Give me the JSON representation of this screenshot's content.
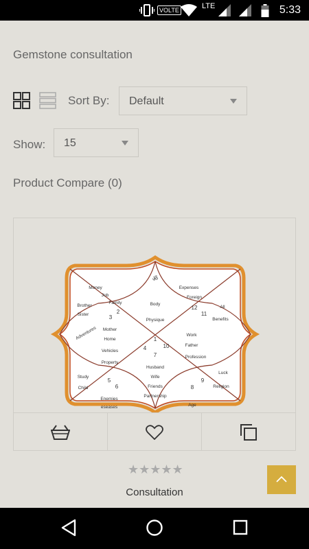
{
  "status_bar": {
    "time": "5:33",
    "network": "LTE",
    "volte": "VOLTE",
    "icons": [
      "vibrate-icon",
      "wifi-icon",
      "signal-icon",
      "signal-icon",
      "battery-icon"
    ]
  },
  "page": {
    "title": "Gemstone consultation",
    "sort": {
      "label": "Sort By:",
      "value": "Default"
    },
    "show": {
      "label": "Show:",
      "value": "15"
    },
    "compare": "Product Compare (0)",
    "view_modes": [
      "grid-view-icon",
      "list-view-icon"
    ]
  },
  "product": {
    "name": "Consultation",
    "rating": 0,
    "rating_max": 5,
    "stars": "★★★★★",
    "actions": [
      "add-to-cart-icon",
      "wishlist-icon",
      "compare-icon"
    ],
    "chart": {
      "colors": {
        "outer": "#d87a2a",
        "inner": "#c24a1f",
        "lines": "#8a3a2a",
        "text": "#333"
      },
      "houses": [
        {
          "num": "1",
          "lines": [
            "Body",
            "Physique"
          ]
        },
        {
          "num": "2",
          "lines": [
            "Money",
            "Job",
            "Family"
          ]
        },
        {
          "num": "3",
          "lines": [
            "Brother",
            "Sister"
          ]
        },
        {
          "num": "4",
          "lines": [
            "Mother",
            "Home",
            "Vehicles",
            "Property"
          ]
        },
        {
          "num": "5",
          "lines": [
            "Study",
            "Child"
          ]
        },
        {
          "num": "6",
          "lines": [
            "Enemies",
            "eseases"
          ]
        },
        {
          "num": "7",
          "lines": [
            "Husband",
            "Wife",
            "Friends",
            "Partnership"
          ]
        },
        {
          "num": "8",
          "lines": [
            "Age"
          ]
        },
        {
          "num": "9",
          "lines": [
            "Luck",
            "Religion"
          ]
        },
        {
          "num": "10",
          "lines": [
            "Work",
            "Father",
            "Profession"
          ]
        },
        {
          "num": "11",
          "lines": [
            "All",
            "Benefits"
          ]
        },
        {
          "num": "12",
          "lines": [
            "Expenses",
            "Foreign"
          ]
        }
      ],
      "side_label": "Adventures",
      "top_symbol": "ॐ"
    }
  },
  "nav_bar": {
    "buttons": [
      "back-icon",
      "home-icon",
      "recents-icon"
    ]
  }
}
